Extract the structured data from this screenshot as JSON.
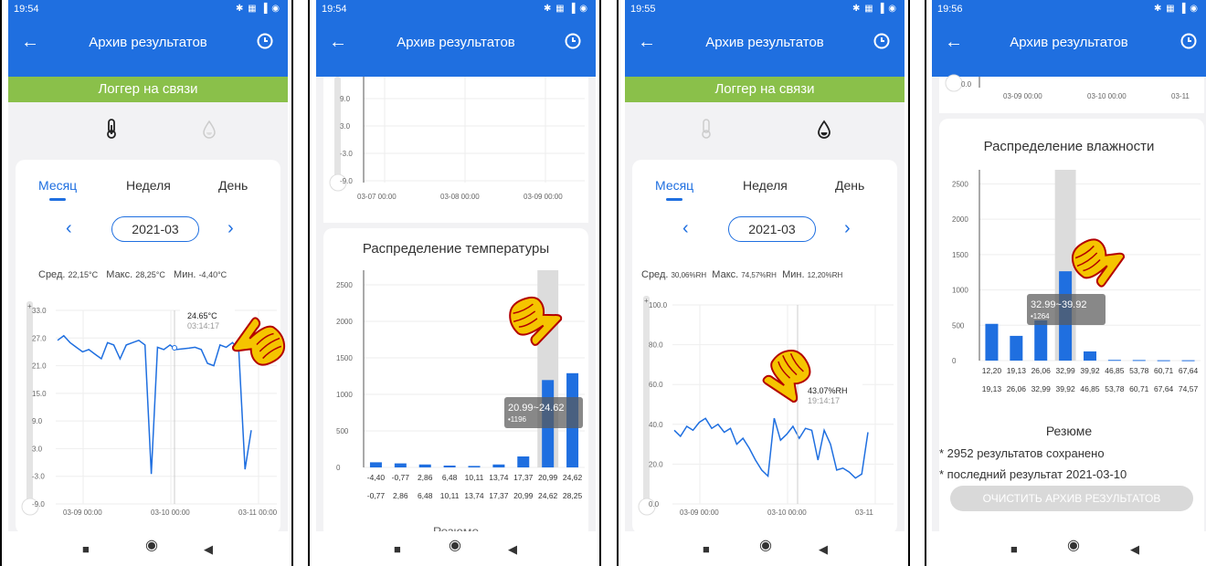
{
  "status_bar": {
    "times": [
      "19:54",
      "19:54",
      "19:55",
      "19:56"
    ],
    "icons": "✱ ▦ ▐ ◉"
  },
  "appbar": {
    "title": "Архив результатов",
    "back_icon": "back-arrow-icon",
    "history_icon": "clock-icon"
  },
  "banner": {
    "text": "Логгер на связи",
    "color": "#8ac04a"
  },
  "accent": "#1f6fe0",
  "tabs": [
    "Месяц",
    "Неделя",
    "День"
  ],
  "period": "2021-03",
  "screen1": {
    "stats": {
      "avg_label": "Сред.",
      "avg": "22,15°C",
      "max_label": "Макс.",
      "max": "28,25°C",
      "min_label": "Мин.",
      "min": "-4,40°C"
    },
    "chart_data": {
      "type": "line",
      "y_ticks": [
        "33.0",
        "27.0",
        "21.0",
        "15.0",
        "9.0",
        "3.0",
        "-3.0",
        "-9.0"
      ],
      "x_ticks": [
        "03-09 00:00",
        "03-10 00:00",
        "03-11 00:00"
      ],
      "ylim": [
        -9,
        33
      ],
      "tooltip": {
        "value": "24.65°C",
        "time": "03:14:17"
      },
      "series": [
        {
          "values": [
            26.5,
            27.5,
            26,
            25,
            24,
            24.5,
            23.5,
            22.5,
            26,
            25.5,
            22.5,
            25.5,
            26,
            26.5,
            25.5,
            -2.5,
            25,
            24.5,
            25.5,
            24.5,
            24.65,
            24.8,
            25,
            24.5,
            21.5,
            21,
            25.5,
            25,
            26,
            24.5,
            -1.5,
            7
          ]
        }
      ]
    }
  },
  "screen2": {
    "top_chart": {
      "y_ticks": [
        "9.0",
        "3.0",
        "-3.0",
        "-9.0"
      ],
      "x_ticks": [
        "03-07 00:00",
        "03-08 00:00",
        "03-09 00:00"
      ]
    },
    "title": "Распределение температуры",
    "chart_data": {
      "type": "bar",
      "categories_from": [
        "-4,40",
        "-0,77",
        "2,86",
        "6,48",
        "10,11",
        "13,74",
        "17,37",
        "20,99",
        "24,62"
      ],
      "categories_to": [
        "-0,77",
        "2,86",
        "6,48",
        "10,11",
        "13,74",
        "17,37",
        "20,99",
        "24,62",
        "28,25"
      ],
      "values": [
        70,
        55,
        40,
        25,
        20,
        40,
        150,
        1196,
        1290
      ],
      "y_ticks": [
        "2500",
        "2000",
        "1500",
        "1000",
        "500",
        "0"
      ],
      "ylim": [
        0,
        2700
      ],
      "tooltip": {
        "range": "20.99~24.62",
        "count": "•1196"
      }
    },
    "summary_heading": "Резюме"
  },
  "screen3": {
    "stats": {
      "avg_label": "Сред.",
      "avg": "30,06%RH",
      "max_label": "Макс.",
      "max": "74,57%RH",
      "min_label": "Мин.",
      "min": "12,20%RH"
    },
    "chart_data": {
      "type": "line",
      "y_ticks": [
        "100.0",
        "80.0",
        "60.0",
        "40.0",
        "20.0",
        "0.0"
      ],
      "x_ticks": [
        "03-09 00:00",
        "03-10 00:00",
        "03-11"
      ],
      "ylim": [
        0,
        100
      ],
      "tooltip": {
        "value": "43.07%RH",
        "time": "19:14:17"
      },
      "series": [
        {
          "values": [
            37,
            34,
            39,
            37,
            41,
            43,
            38,
            40,
            36,
            38,
            30,
            33,
            28,
            22,
            17,
            14,
            43.07,
            32,
            35,
            39,
            33,
            38,
            37,
            22,
            37,
            30,
            17,
            18,
            16,
            13,
            15,
            36
          ]
        }
      ]
    }
  },
  "screen4": {
    "top_axis": {
      "y_tick": "0.0",
      "x_ticks": [
        "03-09 00:00",
        "03-10 00:00",
        "03-11"
      ]
    },
    "title": "Распределение влажности",
    "chart_data": {
      "type": "bar",
      "categories_from": [
        "12,20",
        "19,13",
        "26,06",
        "32,99",
        "39,92",
        "46,85",
        "53,78",
        "60,71",
        "67,64"
      ],
      "categories_to": [
        "19,13",
        "26,06",
        "32,99",
        "39,92",
        "46,85",
        "53,78",
        "60,71",
        "67,64",
        "74,57"
      ],
      "values": [
        520,
        350,
        570,
        1264,
        130,
        10,
        8,
        5,
        5
      ],
      "y_ticks": [
        "2500",
        "2000",
        "1500",
        "1000",
        "500",
        "0"
      ],
      "ylim": [
        0,
        2700
      ],
      "tooltip": {
        "range": "32.99~39.92",
        "count": "•1264"
      }
    },
    "summary_heading": "Резюме",
    "saved_text": "* 2952 результатов сохранено",
    "last_text": "* последний результат 2021-03-10",
    "clear_button": "ОЧИСТИТЬ АРХИВ РЕЗУЛЬТАТОВ"
  }
}
